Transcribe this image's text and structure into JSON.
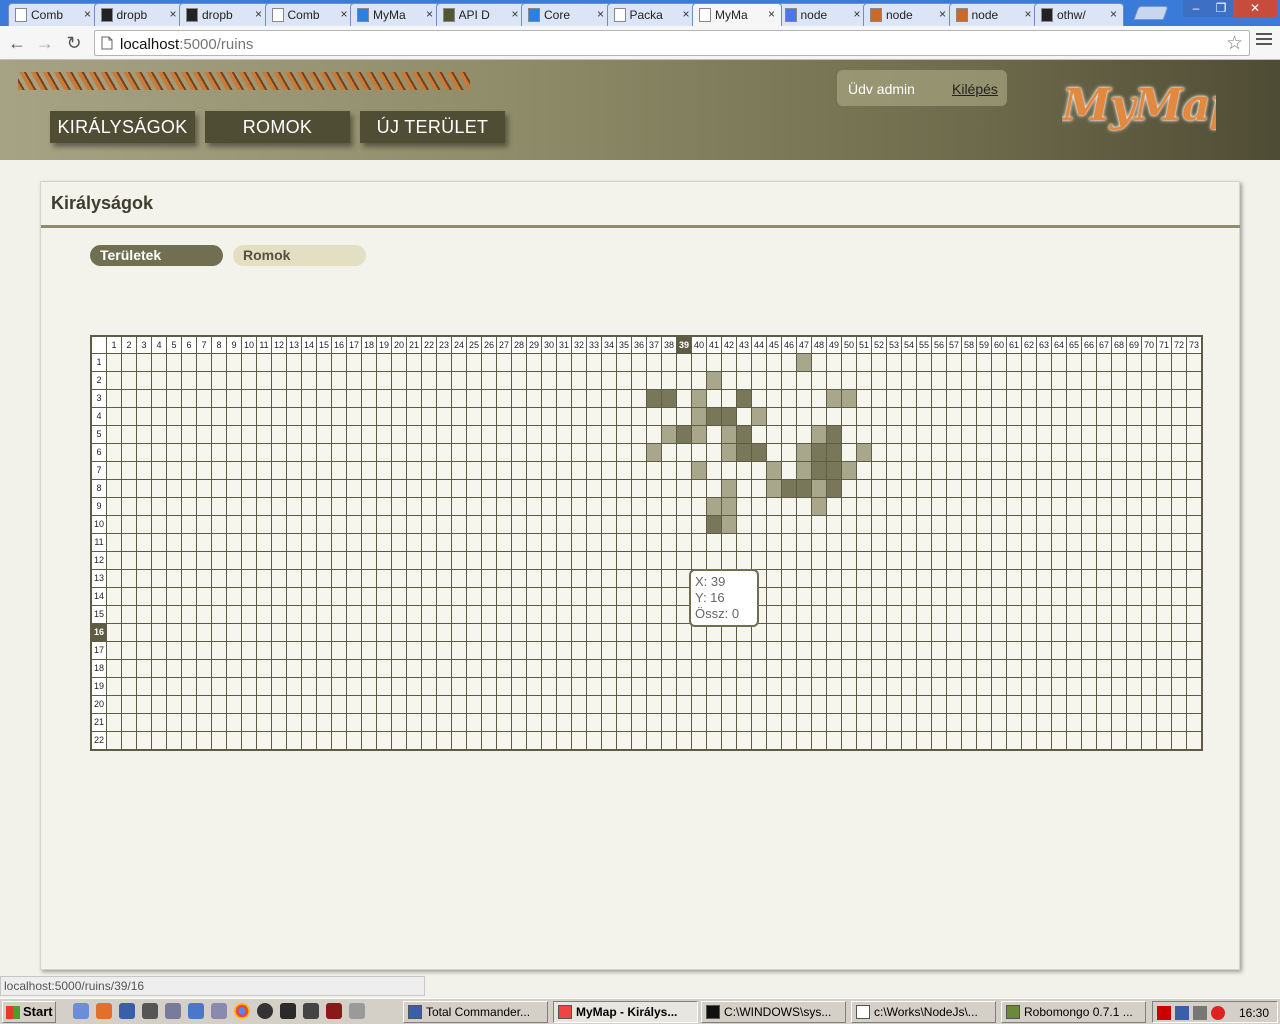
{
  "browser": {
    "tabs": [
      {
        "title": "Comb",
        "icon": "page-icon"
      },
      {
        "title": "dropb",
        "icon": "github-icon"
      },
      {
        "title": "dropb",
        "icon": "github-icon"
      },
      {
        "title": "Comb",
        "icon": "page-icon"
      },
      {
        "title": "MyMa",
        "icon": "dropbox-icon"
      },
      {
        "title": "API D",
        "icon": "coffee-icon"
      },
      {
        "title": "Core",
        "icon": "dropbox-icon"
      },
      {
        "title": "Packa",
        "icon": "page-icon"
      },
      {
        "title": "MyMa",
        "icon": "page-icon",
        "active": true
      },
      {
        "title": "node",
        "icon": "google-icon"
      },
      {
        "title": "node",
        "icon": "stackoverflow-icon"
      },
      {
        "title": "node",
        "icon": "stackoverflow-icon"
      },
      {
        "title": "othw/",
        "icon": "github-icon"
      }
    ],
    "url_host": "localhost",
    "url_path": ":5000/ruins",
    "status_url": "localhost:5000/ruins/39/16",
    "tab_close_glyph": "×"
  },
  "header": {
    "nav": [
      "KIRÁLYSÁGOK",
      "ROMOK",
      "ÚJ TERÜLET"
    ],
    "greeting": "Üdv admin",
    "logout": "Kilépés",
    "logo": "MyMap"
  },
  "panel": {
    "title": "Királyságok",
    "tabs": [
      "Területek",
      "Romok"
    ]
  },
  "grid": {
    "cols": 73,
    "rows": 22,
    "selected_col": 39,
    "selected_row": 16,
    "dark_cells": [
      [
        37,
        3
      ],
      [
        38,
        3
      ],
      [
        43,
        3
      ],
      [
        41,
        4
      ],
      [
        42,
        4
      ],
      [
        39,
        5
      ],
      [
        43,
        5
      ],
      [
        49,
        5
      ],
      [
        43,
        6
      ],
      [
        44,
        6
      ],
      [
        48,
        6
      ],
      [
        49,
        6
      ],
      [
        48,
        7
      ],
      [
        49,
        7
      ],
      [
        46,
        8
      ],
      [
        47,
        8
      ],
      [
        49,
        8
      ],
      [
        41,
        10
      ]
    ],
    "light_cells": [
      [
        47,
        1
      ],
      [
        41,
        2
      ],
      [
        40,
        3
      ],
      [
        49,
        3
      ],
      [
        50,
        3
      ],
      [
        40,
        4
      ],
      [
        44,
        4
      ],
      [
        38,
        5
      ],
      [
        40,
        5
      ],
      [
        42,
        5
      ],
      [
        48,
        5
      ],
      [
        37,
        6
      ],
      [
        42,
        6
      ],
      [
        47,
        6
      ],
      [
        51,
        6
      ],
      [
        40,
        7
      ],
      [
        45,
        7
      ],
      [
        47,
        7
      ],
      [
        50,
        7
      ],
      [
        42,
        8
      ],
      [
        45,
        8
      ],
      [
        48,
        8
      ],
      [
        41,
        9
      ],
      [
        42,
        9
      ],
      [
        48,
        9
      ],
      [
        42,
        10
      ]
    ],
    "colors": {
      "dark": "#79775a",
      "light": "#a8a68b",
      "line": "#5e5c42"
    }
  },
  "tooltip": {
    "x_label": "X: 39",
    "y_label": "Y: 16",
    "sum_label": "Össz: 0"
  },
  "taskbar": {
    "start": "Start",
    "windows": [
      {
        "label": "Total Commander...",
        "icon": "total-commander-icon"
      },
      {
        "label": "MyMap - Királys...",
        "icon": "chrome-icon",
        "active": true
      },
      {
        "label": "C:\\WINDOWS\\sys...",
        "icon": "cmd-icon"
      },
      {
        "label": "c:\\Works\\NodeJs\\...",
        "icon": "notepad-icon"
      },
      {
        "label": "Robomongo 0.7.1 ...",
        "icon": "robomongo-icon"
      }
    ],
    "clock": "16:30"
  }
}
